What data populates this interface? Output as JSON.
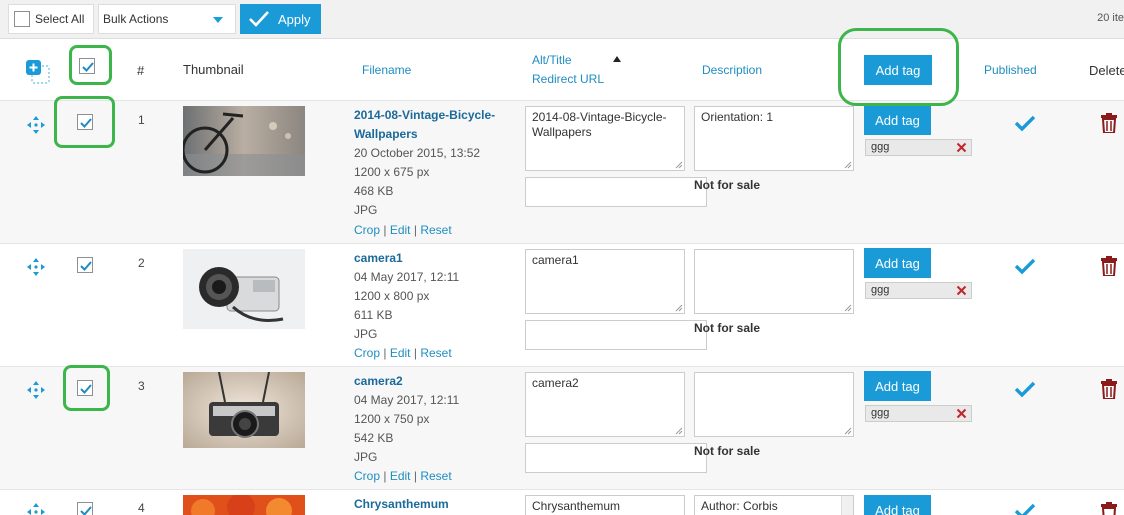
{
  "toolbar": {
    "select_all_label": "Select All",
    "bulk_actions_value": "Bulk Actions",
    "apply_label": "Apply",
    "item_count": "20 ite"
  },
  "header": {
    "number": "#",
    "thumbnail": "Thumbnail",
    "filename": "Filename",
    "alt_title": "Alt/Title",
    "redirect_url": "Redirect URL",
    "description": "Description",
    "add_tag": "Add tag",
    "published": "Published",
    "delete": "Delete"
  },
  "rows": [
    {
      "number": "1",
      "checked": true,
      "filename": "2014-08-Vintage-Bicycle-Wallpapers",
      "date": "20 October 2015, 13:52",
      "dimensions": "1200 x 675 px",
      "size": "468 KB",
      "type": "JPG",
      "alt": "2014-08-Vintage-Bicycle-Wallpapers",
      "description": "Orientation: 1",
      "not_for_sale": "Not for sale",
      "add_tag": "Add tag",
      "tag": "ggg",
      "published": true
    },
    {
      "number": "2",
      "checked": true,
      "filename": "camera1",
      "date": "04 May 2017, 12:11",
      "dimensions": "1200 x 800 px",
      "size": "611 KB",
      "type": "JPG",
      "alt": "camera1",
      "description": "",
      "not_for_sale": "Not for sale",
      "add_tag": "Add tag",
      "tag": "ggg",
      "published": true
    },
    {
      "number": "3",
      "checked": true,
      "filename": "camera2",
      "date": "04 May 2017, 12:11",
      "dimensions": "1200 x 750 px",
      "size": "542 KB",
      "type": "JPG",
      "alt": "camera2",
      "description": "",
      "not_for_sale": "Not for sale",
      "add_tag": "Add tag",
      "tag": "ggg",
      "published": true
    },
    {
      "number": "4",
      "checked": true,
      "filename": "Chrysanthemum",
      "alt": "Chrysanthemum",
      "description": "Author: Corbis",
      "add_tag": "Add tag",
      "published": true
    }
  ],
  "row_links": {
    "crop": "Crop",
    "edit": "Edit",
    "reset": "Reset",
    "separator": "|"
  },
  "colors": {
    "accent": "#1a9bd7",
    "link": "#1f8dc0",
    "highlight": "#3cb54a",
    "delete": "#8b1a1a"
  }
}
